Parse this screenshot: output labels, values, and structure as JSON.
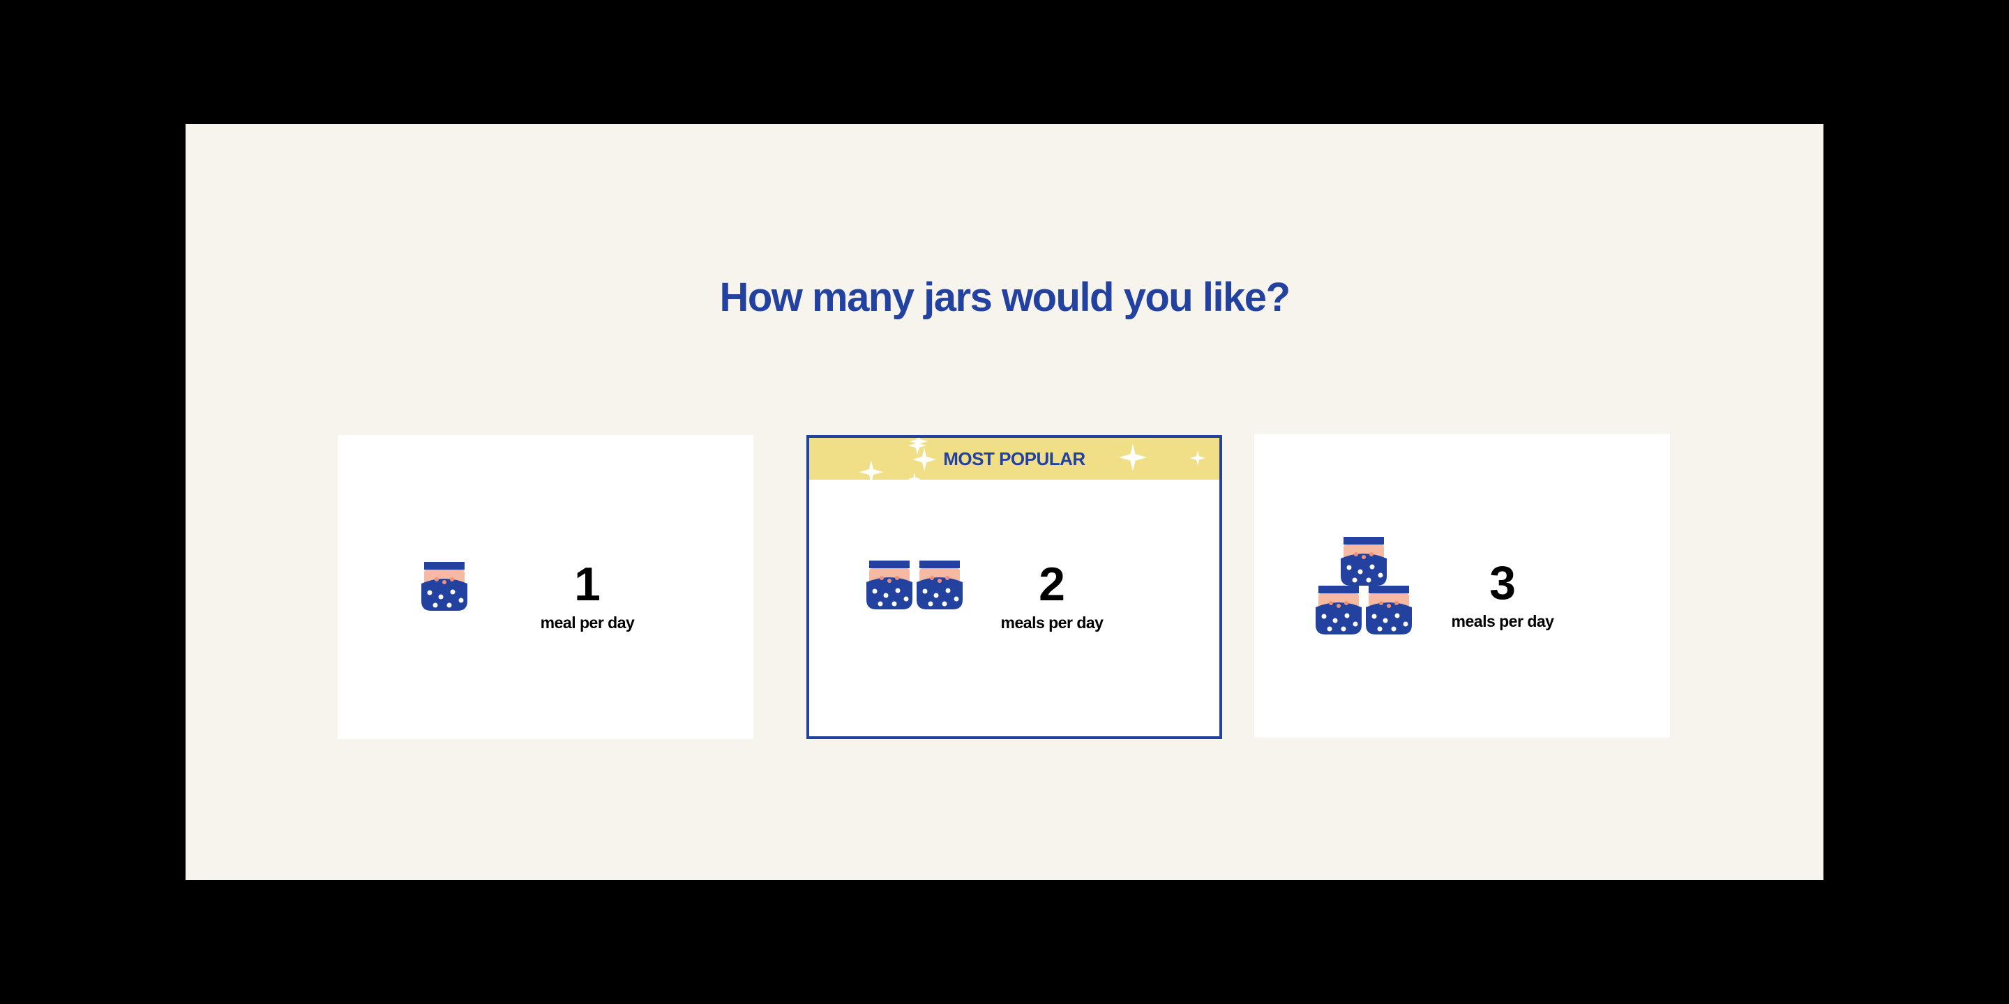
{
  "page": {
    "heading": "How many jars would you like?"
  },
  "options": [
    {
      "number": "1",
      "label": "meal per day",
      "jar_count": 1,
      "selected": false
    },
    {
      "number": "2",
      "label": "meals per day",
      "jar_count": 2,
      "selected": true,
      "badge": "MOST POPULAR"
    },
    {
      "number": "3",
      "label": "meals per day",
      "jar_count": 3,
      "selected": false
    }
  ],
  "colors": {
    "brand_blue": "#2342a0",
    "background": "#f7f4ee",
    "badge_yellow": "#f1df88",
    "jar_pink": "#f6b9a2",
    "jar_dot": "#f08f78"
  },
  "icons": [
    "jar-icon",
    "sparkle-icon"
  ]
}
